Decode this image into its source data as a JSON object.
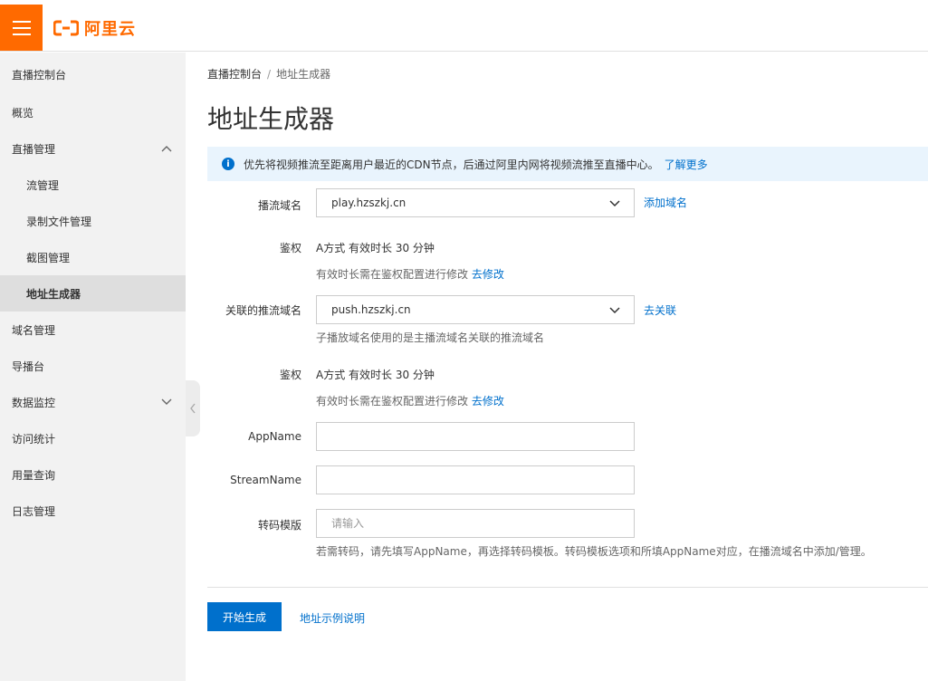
{
  "header": {
    "brand": "阿里云",
    "menu_icon": "hamburger-icon",
    "accent": "#ff6a00"
  },
  "sidebar": {
    "items": [
      {
        "label": "直播控制台"
      },
      {
        "label": "概览"
      },
      {
        "label": "直播管理",
        "expanded": true
      },
      {
        "label": "流管理"
      },
      {
        "label": "录制文件管理"
      },
      {
        "label": "截图管理"
      },
      {
        "label": "地址生成器",
        "active": true
      },
      {
        "label": "域名管理"
      },
      {
        "label": "导播台"
      },
      {
        "label": "数据监控",
        "expanded": false
      },
      {
        "label": "访问统计"
      },
      {
        "label": "用量查询"
      },
      {
        "label": "日志管理"
      }
    ]
  },
  "breadcrumb": {
    "root": "直播控制台",
    "sep": "/",
    "current": "地址生成器"
  },
  "page": {
    "title": "地址生成器"
  },
  "notice": {
    "text": "优先将视频推流至距离用户最近的CDN节点，后通过阿里内网将视频流推至直播中心。",
    "link": "了解更多"
  },
  "form": {
    "play_domain": {
      "label": "播流域名",
      "value": "play.hzszkj.cn",
      "action": "添加域名"
    },
    "auth1": {
      "label": "鉴权",
      "value": "A方式 有效时长 30 分钟",
      "hint": "有效时长需在鉴权配置进行修改",
      "hint_link": "去修改"
    },
    "push_domain": {
      "label": "关联的推流域名",
      "value": "push.hzszkj.cn",
      "action": "去关联",
      "hint": "子播放域名使用的是主播流域名关联的推流域名"
    },
    "auth2": {
      "label": "鉴权",
      "value": "A方式 有效时长 30 分钟",
      "hint": "有效时长需在鉴权配置进行修改",
      "hint_link": "去修改"
    },
    "app_name": {
      "label": "AppName",
      "value": ""
    },
    "stream_name": {
      "label": "StreamName",
      "value": ""
    },
    "transcode": {
      "label": "转码模版",
      "placeholder": "请输入",
      "hint": "若需转码，请先填写AppName，再选择转码模板。转码模板选项和所填AppName对应，在播流域名中添加/管理。"
    }
  },
  "actions": {
    "generate": "开始生成",
    "example": "地址示例说明"
  },
  "colors": {
    "primary": "#0070cc",
    "notice_bg": "#e9f4fd",
    "sidebar_bg": "#f2f2f2"
  }
}
